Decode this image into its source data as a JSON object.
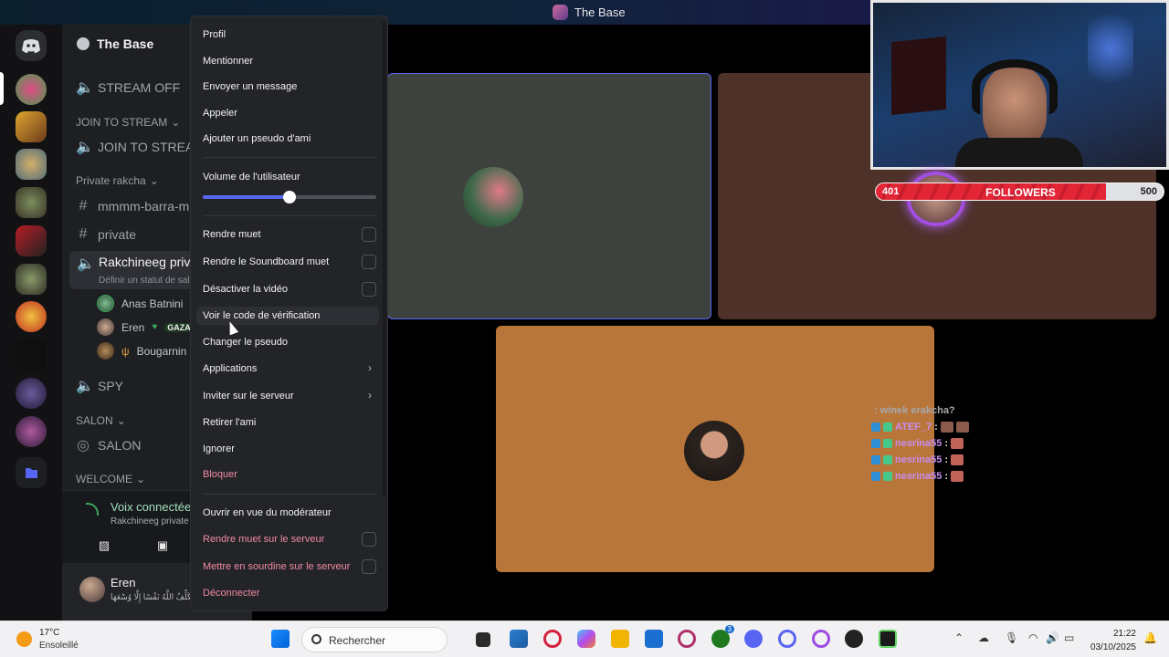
{
  "window": {
    "title": "The Base"
  },
  "server": {
    "name": "The Base"
  },
  "channels": {
    "stream_off": "STREAM OFF",
    "cat_join": "JOIN TO STREAM",
    "join_to_stream": "JOIN TO STREAM",
    "cat_private": "Private rakcha",
    "mmmm": "mmmm-barra-mr",
    "private": "private",
    "rakchineeg": "Rakchineeg privat",
    "rakchineeg_sub": "Définir un statut de salo",
    "members": [
      {
        "name": "Anas Batnini"
      },
      {
        "name": "Eren",
        "badge": "GAZA"
      },
      {
        "name": "Bougarnin"
      }
    ],
    "spy": "SPY",
    "cat_salon": "SALON",
    "salon": "SALON",
    "cat_welcome": "WELCOME"
  },
  "voice": {
    "title": "Voix connectée",
    "sub": "Rakchineeg private / The Base"
  },
  "user": {
    "name": "Eren",
    "status": "لَا يُكَلِّفُ اللَّهُ نَفْسًا إِلَّا وُسْعَهَا ·"
  },
  "menu": {
    "profile": "Profil",
    "mention": "Mentionner",
    "message": "Envoyer un message",
    "call": "Appeler",
    "nickname": "Ajouter un pseudo d'ami",
    "volume_label": "Volume de l'utilisateur",
    "volume": 0.5,
    "mute": "Rendre muet",
    "mute_soundboard": "Rendre le Soundboard muet",
    "disable_video": "Désactiver la vidéo",
    "verify": "Voir le code de vérification",
    "change_nick": "Changer le pseudo",
    "apps": "Applications",
    "invite": "Inviter sur le serveur",
    "remove_friend": "Retirer l'ami",
    "ignore": "Ignorer",
    "block": "Bloquer",
    "moderator_view": "Ouvrir en vue du modérateur",
    "server_mute": "Rendre muet sur le serveur",
    "server_deafen": "Mettre en sourdine sur le serveur",
    "disconnect": "Déconnecter"
  },
  "overlay": {
    "followers_current": "401",
    "followers_label": "FOLLOWERS",
    "followers_goal": "500",
    "followers_progress": 0.8,
    "chat": [
      {
        "user": "",
        "msg": ": winek erakcha?"
      },
      {
        "user": "ATEF_7",
        "msg": ":"
      },
      {
        "user": "nesrina55",
        "msg": ":"
      },
      {
        "user": "nesrina55",
        "msg": ":"
      },
      {
        "user": "nesrina55",
        "msg": ":"
      }
    ]
  },
  "taskbar": {
    "temp": "17°C",
    "weather": "Ensoleillé",
    "search": "Rechercher",
    "time": "21:22",
    "date": "03/10/2025",
    "xbox_badge": "3"
  },
  "colors": {
    "accent": "#5865f2",
    "danger": "#f08ba2",
    "connected": "#3ba55d"
  }
}
